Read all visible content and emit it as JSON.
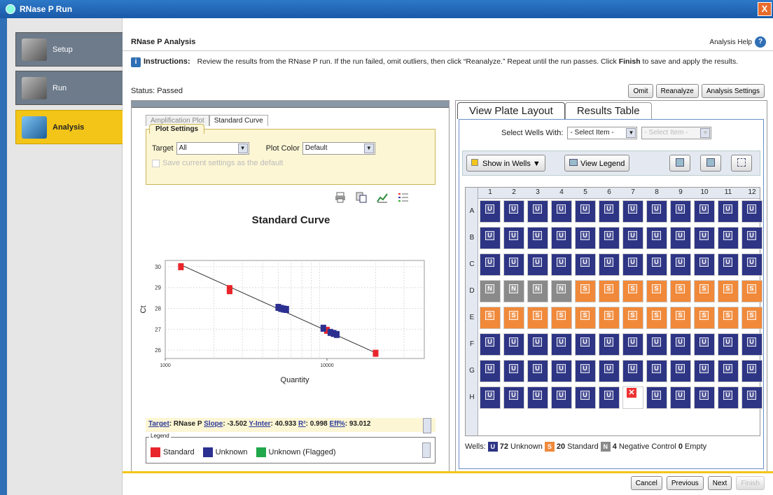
{
  "window": {
    "title": "RNase P Run",
    "close": "X"
  },
  "nav": [
    {
      "label": "Setup"
    },
    {
      "label": "Run"
    },
    {
      "label": "Analysis"
    }
  ],
  "header": {
    "title": "RNase P Analysis",
    "help": "Analysis Help",
    "help_icon": "?"
  },
  "instructions": {
    "icon": "i",
    "label": "Instructions:",
    "text_before": "Review the results from the RNase P run. If the run failed, omit outliers, then click “Reanalyze.” Repeat until the run passes. Click ",
    "text_bold": "Finish",
    "text_after": " to save and apply the results."
  },
  "status": "Status: Passed",
  "top_buttons": {
    "omit": "Omit",
    "reanalyze": "Reanalyze",
    "settings": "Analysis Settings"
  },
  "left": {
    "tabs": [
      "Amplification Plot",
      "Standard Curve"
    ],
    "plot_settings": {
      "title": "Plot Settings",
      "target_label": "Target",
      "target_value": "All",
      "color_label": "Plot Color",
      "color_value": "Default",
      "save_default": "Save current settings as the default"
    },
    "stats": {
      "target_label": "Target",
      "target_value": ": RNase P ",
      "slope_label": "Slope",
      "slope_value": ": -3.502 ",
      "yinter_label": "Y-Inter",
      "yinter_value": ": 40.933 ",
      "r2_label": "R²",
      "r2_value": ": 0.998 ",
      "eff_label": "Eff%",
      "eff_value": ": 93.012"
    },
    "legend": {
      "title": "Legend",
      "items": [
        {
          "label": "Standard",
          "color": "#e8252b"
        },
        {
          "label": "Unknown",
          "color": "#2b2f8f"
        },
        {
          "label": "Unknown (Flagged)",
          "color": "#21a84a"
        }
      ]
    }
  },
  "chart_data": {
    "type": "scatter",
    "title": "Standard Curve",
    "xlabel": "Quantity",
    "ylabel": "Ct",
    "x_scale": "log",
    "xlim": [
      1000,
      40000
    ],
    "ylim": [
      25.6,
      30.3
    ],
    "xticks": [
      1000,
      10000
    ],
    "xtick_labels": [
      "1000",
      "10000"
    ],
    "yticks": [
      26,
      27,
      28,
      29,
      30
    ],
    "grid": true,
    "fit_line": {
      "slope": -3.502,
      "intercept": 40.933
    },
    "series": [
      {
        "name": "Standard",
        "color": "#e8252b",
        "points": [
          {
            "x": 1250,
            "y": 30.0
          },
          {
            "x": 2500,
            "y": 28.95
          },
          {
            "x": 2500,
            "y": 28.85
          },
          {
            "x": 10000,
            "y": 26.95
          },
          {
            "x": 20000,
            "y": 25.85
          }
        ]
      },
      {
        "name": "Unknown",
        "color": "#2b2f8f",
        "points": [
          {
            "x": 5000,
            "y": 28.05
          },
          {
            "x": 5200,
            "y": 28.0
          },
          {
            "x": 5400,
            "y": 27.97
          },
          {
            "x": 5600,
            "y": 27.95
          },
          {
            "x": 9500,
            "y": 27.05
          },
          {
            "x": 10500,
            "y": 26.85
          },
          {
            "x": 11000,
            "y": 26.8
          },
          {
            "x": 11500,
            "y": 26.75
          }
        ]
      }
    ]
  },
  "right": {
    "tabs": [
      "View Plate Layout",
      "Results Table"
    ],
    "select_label": "Select Wells With:",
    "select1": "- Select Item -",
    "select2": "- Select Item -",
    "show_in_wells": "Show in Wells ▼",
    "view_legend": "View Legend",
    "columns": [
      "1",
      "2",
      "3",
      "4",
      "5",
      "6",
      "7",
      "8",
      "9",
      "10",
      "11",
      "12"
    ],
    "rows": [
      "A",
      "B",
      "C",
      "D",
      "E",
      "F",
      "G",
      "H"
    ],
    "plate": [
      [
        "U",
        "U",
        "U",
        "U",
        "U",
        "U",
        "U",
        "U",
        "U",
        "U",
        "U",
        "U"
      ],
      [
        "U",
        "U",
        "U",
        "U",
        "U",
        "U",
        "U",
        "U",
        "U",
        "U",
        "U",
        "U"
      ],
      [
        "U",
        "U",
        "U",
        "U",
        "U",
        "U",
        "U",
        "U",
        "U",
        "U",
        "U",
        "U"
      ],
      [
        "N",
        "N",
        "N",
        "N",
        "S",
        "S",
        "S",
        "S",
        "S",
        "S",
        "S",
        "S"
      ],
      [
        "S",
        "S",
        "S",
        "S",
        "S",
        "S",
        "S",
        "S",
        "S",
        "S",
        "S",
        "S"
      ],
      [
        "U",
        "U",
        "U",
        "U",
        "U",
        "U",
        "U",
        "U",
        "U",
        "U",
        "U",
        "U"
      ],
      [
        "U",
        "U",
        "U",
        "U",
        "U",
        "U",
        "U",
        "U",
        "U",
        "U",
        "U",
        "U"
      ],
      [
        "U",
        "U",
        "U",
        "U",
        "U",
        "U",
        "X",
        "U",
        "U",
        "U",
        "U",
        "U"
      ]
    ],
    "well_colors": {
      "U": "#2e3585",
      "S": "#f0893a",
      "N": "#8a8a8a"
    },
    "wells": {
      "label": "Wells:",
      "u_count": "72",
      "u_label": "Unknown",
      "s_count": "20",
      "s_label": "Standard",
      "n_count": "4",
      "n_label": "Negative Control",
      "e_count": "0",
      "e_label": "Empty"
    }
  },
  "bottom_buttons": {
    "cancel": "Cancel",
    "previous": "Previous",
    "next": "Next",
    "finish": "Finish"
  }
}
